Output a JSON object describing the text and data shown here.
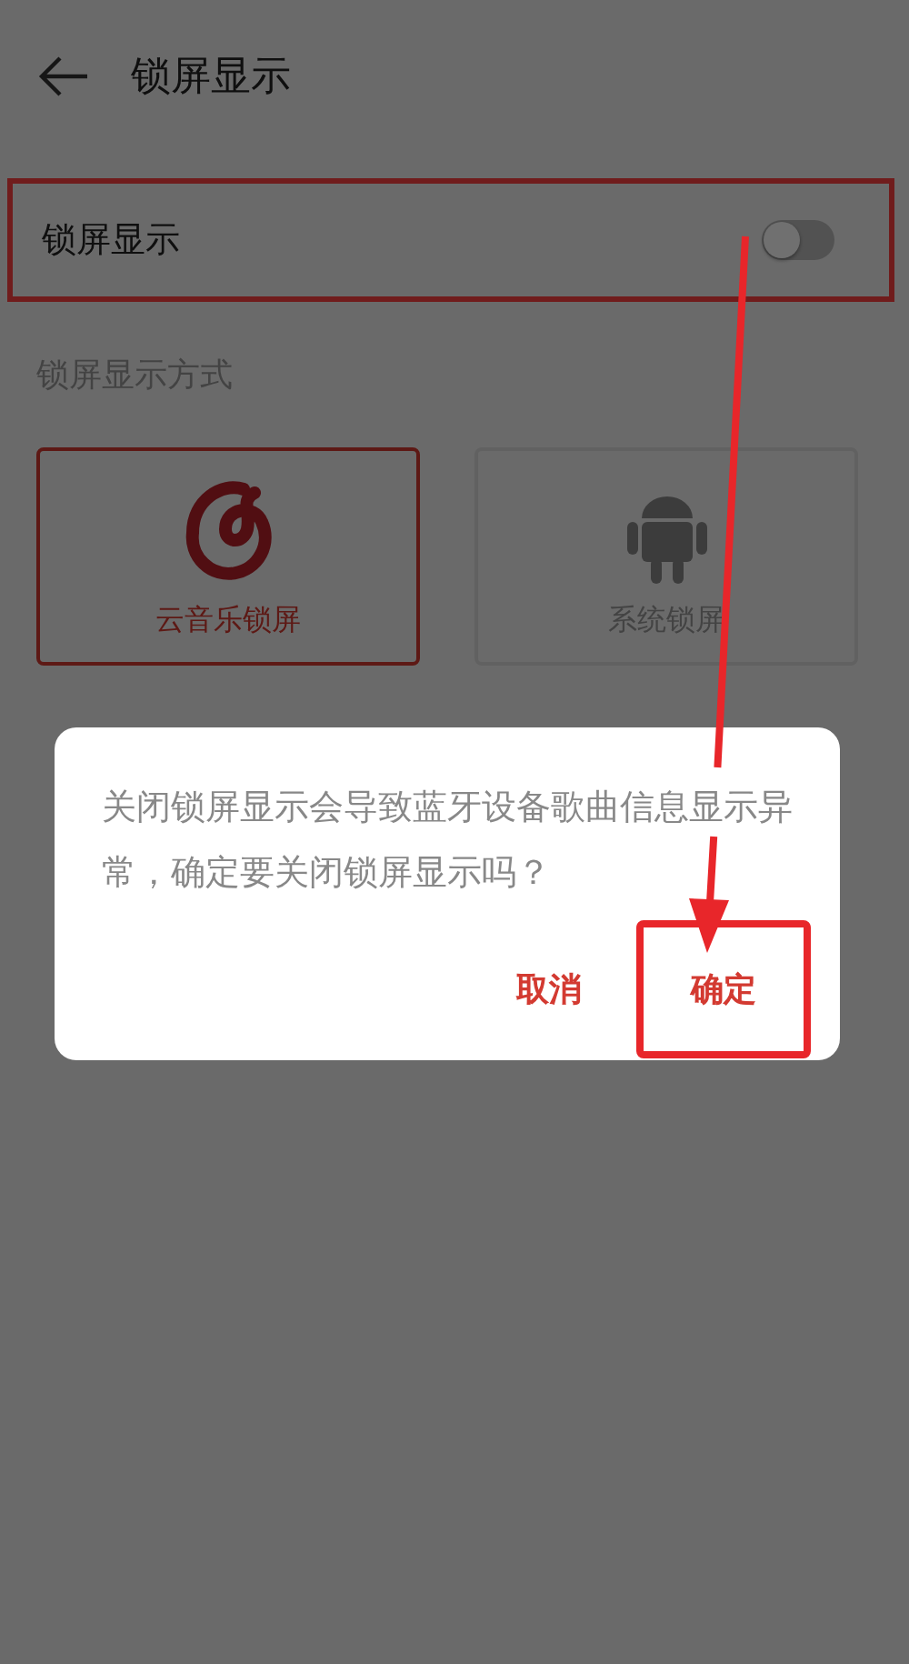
{
  "header": {
    "title": "锁屏显示"
  },
  "setting": {
    "label": "锁屏显示",
    "on": false
  },
  "section_label": "锁屏显示方式",
  "modes": [
    {
      "label": "云音乐锁屏",
      "kind": "app",
      "selected": true
    },
    {
      "label": "系统锁屏",
      "kind": "system",
      "selected": false
    }
  ],
  "dialog": {
    "message": "关闭锁屏显示会导致蓝牙设备歌曲信息显示异常，确定要关闭锁屏显示吗？",
    "buttons": [
      {
        "label": "取消",
        "highlighted": false
      },
      {
        "label": "确定",
        "highlighted": true
      }
    ]
  }
}
